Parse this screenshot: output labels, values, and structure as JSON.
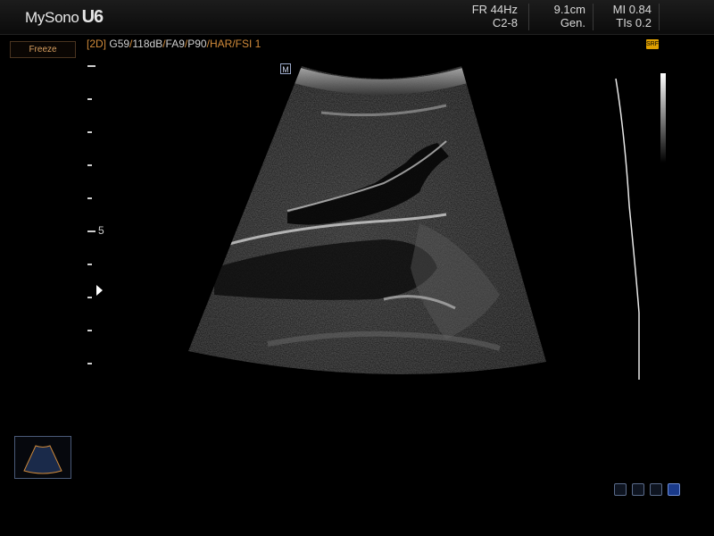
{
  "app": {
    "brand": "MySono",
    "model": "U6"
  },
  "header": {
    "frame_rate": "FR 44Hz",
    "probe": "C2-8",
    "depth": "9.1cm",
    "preset": "Gen.",
    "mi": "MI 0.84",
    "tis": "TIs 0.2"
  },
  "controls": {
    "freeze_label": "Freeze"
  },
  "params": {
    "mode": "[2D]",
    "gain": "G59",
    "dynamic_range": "118dB",
    "frame_avg": "FA9",
    "power": "P90",
    "har": "HAR",
    "fsi": "FSI 1"
  },
  "depth_ruler": {
    "label": "5"
  },
  "orientation_marker": "M",
  "srf_badge": "SRF",
  "icons": [
    "probe-status-icon",
    "network-icon",
    "usb-icon",
    "disk-icon"
  ],
  "colors": {
    "accent": "#d08a3a",
    "srf": "#e0a000",
    "background": "#000000"
  }
}
